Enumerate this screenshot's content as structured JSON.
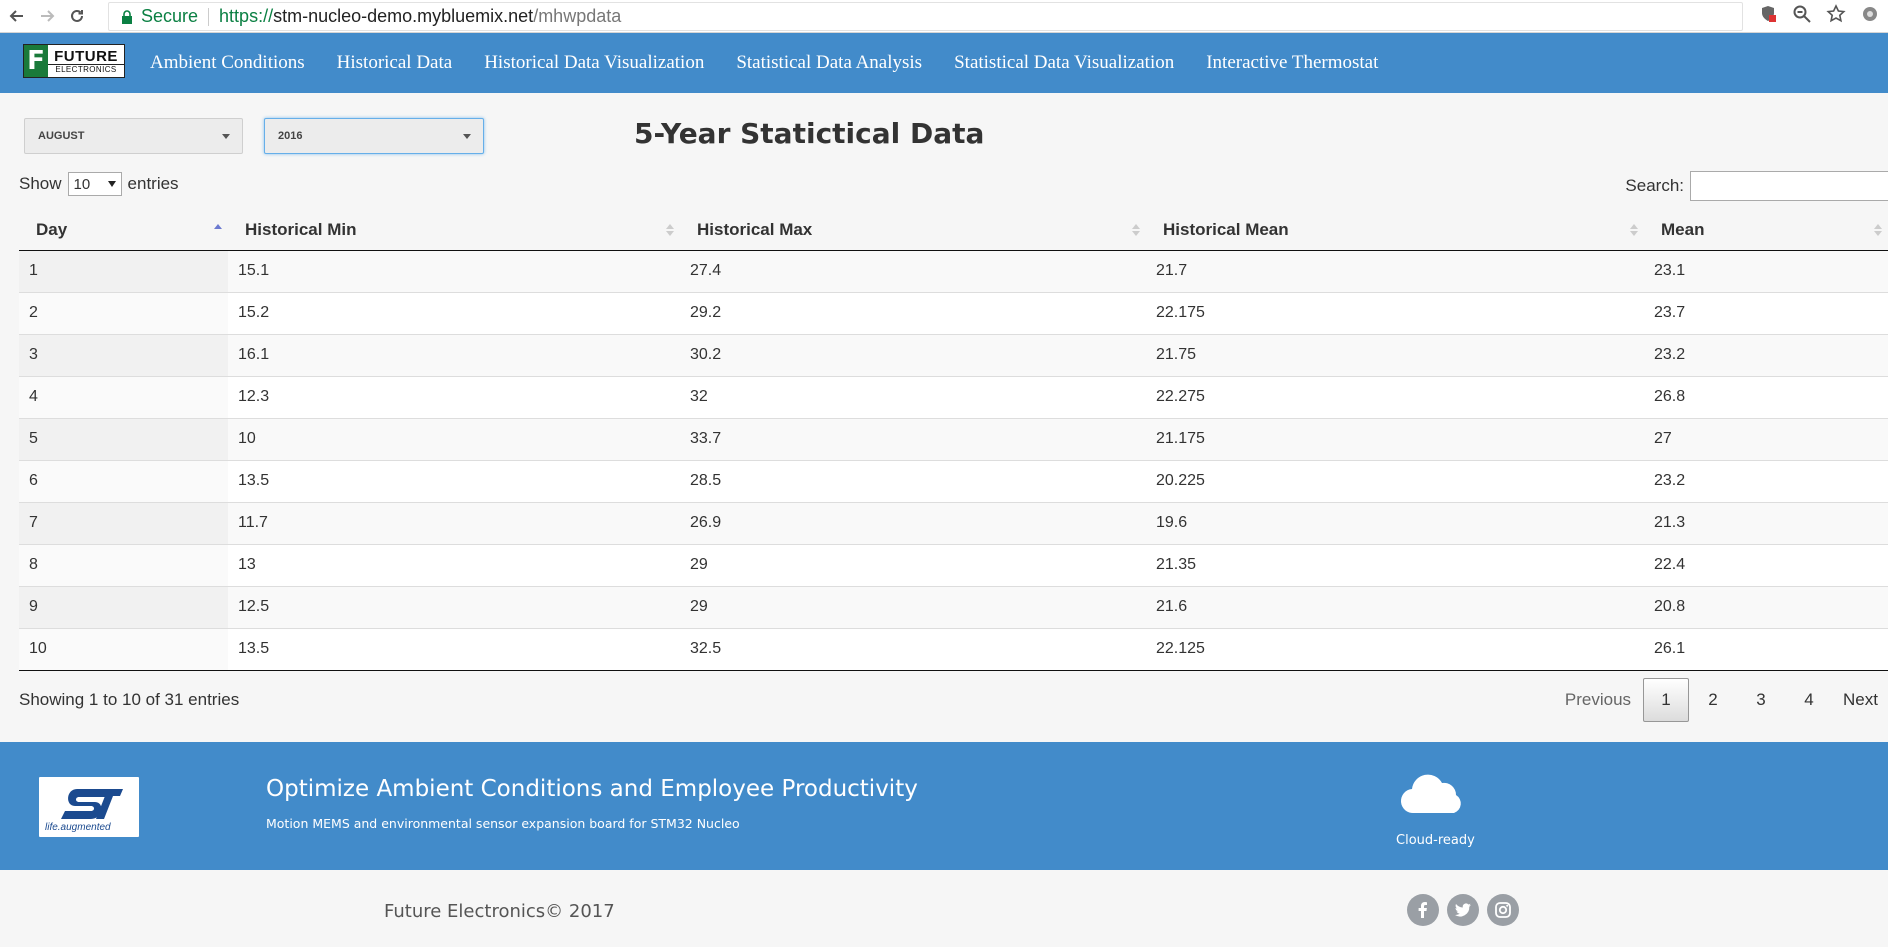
{
  "browser": {
    "secure_label": "Secure",
    "url_scheme": "https://",
    "url_host": "stm-nucleo-demo.mybluemix.net",
    "url_path": "/mhwpdata"
  },
  "brand": {
    "line1": "FUTURE",
    "line2": "ELECTRONICS",
    "letter": "F"
  },
  "nav": {
    "items": [
      "Ambient Conditions",
      "Historical Data",
      "Historical Data Visualization",
      "Statistical Data Analysis",
      "Statistical Data Visualization",
      "Interactive Thermostat"
    ]
  },
  "filters": {
    "month": "AUGUST",
    "year": "2016"
  },
  "page_title": "5-Year Statictical Data",
  "table_controls": {
    "show_label": "Show",
    "page_length": "10",
    "entries_label": "entries",
    "search_label": "Search:",
    "search_value": ""
  },
  "table": {
    "columns": [
      "Day",
      "Historical Min",
      "Historical Max",
      "Historical Mean",
      "Mean"
    ],
    "rows": [
      [
        "1",
        "15.1",
        "27.4",
        "21.7",
        "23.1"
      ],
      [
        "2",
        "15.2",
        "29.2",
        "22.175",
        "23.7"
      ],
      [
        "3",
        "16.1",
        "30.2",
        "21.75",
        "23.2"
      ],
      [
        "4",
        "12.3",
        "32",
        "22.275",
        "26.8"
      ],
      [
        "5",
        "10",
        "33.7",
        "21.175",
        "27"
      ],
      [
        "6",
        "13.5",
        "28.5",
        "20.225",
        "23.2"
      ],
      [
        "7",
        "11.7",
        "26.9",
        "19.6",
        "21.3"
      ],
      [
        "8",
        "13",
        "29",
        "21.35",
        "22.4"
      ],
      [
        "9",
        "12.5",
        "29",
        "21.6",
        "20.8"
      ],
      [
        "10",
        "13.5",
        "32.5",
        "22.125",
        "26.1"
      ]
    ]
  },
  "info_text": "Showing 1 to 10 of 31 entries",
  "pagination": {
    "previous": "Previous",
    "pages": [
      "1",
      "2",
      "3",
      "4"
    ],
    "current": "1",
    "next": "Next"
  },
  "footer_band": {
    "logo_text": "life.augmented",
    "heading": "Optimize Ambient Conditions and Employee Productivity",
    "subheading": "Motion MEMS and environmental sensor expansion board for STM32 Nucleo",
    "cloud_label": "Cloud-ready"
  },
  "footer": {
    "copyright": "Future Electronics© 2017",
    "social": [
      "facebook-icon",
      "twitter-icon",
      "instagram-icon"
    ]
  },
  "colors": {
    "nav_bg": "#428bca",
    "secure_green": "#0b8043",
    "brand_green": "#1a7a3a"
  }
}
